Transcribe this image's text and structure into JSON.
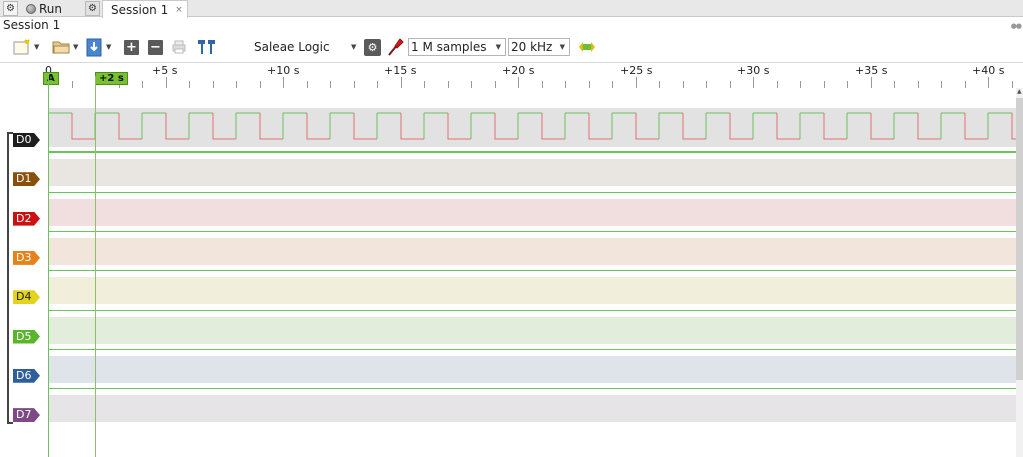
{
  "tabs": {
    "run_label": "Run",
    "session_tab_label": "Session 1",
    "session_tab_close": "×"
  },
  "session": {
    "title": "Session 1"
  },
  "toolbar": {
    "device_name": "Saleae Logic",
    "samples": "1 M samples",
    "rate": "20 kHz",
    "add_label": "+",
    "remove_label": "−"
  },
  "ruler": {
    "ticks": [
      "0",
      "+5 s",
      "+10 s",
      "+15 s",
      "+20 s",
      "+25 s",
      "+30 s",
      "+35 s",
      "+40 s"
    ],
    "marker_a": "A",
    "marker_delta": "+2 s"
  },
  "channels": [
    {
      "label": "D0",
      "color": "#1e1e1e",
      "band": "#e2e2e2",
      "active": true
    },
    {
      "label": "D1",
      "color": "#8a4f0c",
      "band": "#e9e5e1"
    },
    {
      "label": "D2",
      "color": "#cc1010",
      "band": "#f1dfdf"
    },
    {
      "label": "D3",
      "color": "#e5821a",
      "band": "#f2e6dc"
    },
    {
      "label": "D4",
      "color": "#e3d21e",
      "band": "#f1efdc"
    },
    {
      "label": "D5",
      "color": "#5ab52c",
      "band": "#e3eddc"
    },
    {
      "label": "D6",
      "color": "#2f5e9e",
      "band": "#dfe4ea"
    },
    {
      "label": "D7",
      "color": "#7d4a86",
      "band": "#e6e4e6"
    }
  ],
  "colors": {
    "signal_high": "#6cc25c",
    "signal_low": "#e07070",
    "marker": "#78c232"
  },
  "icons": [
    "gear-icon",
    "new-session-icon",
    "open-icon",
    "save-icon",
    "add-icon",
    "remove-icon",
    "print-icon",
    "cursor-icon",
    "probe-icon",
    "trigger-icon",
    "settings-icon"
  ]
}
